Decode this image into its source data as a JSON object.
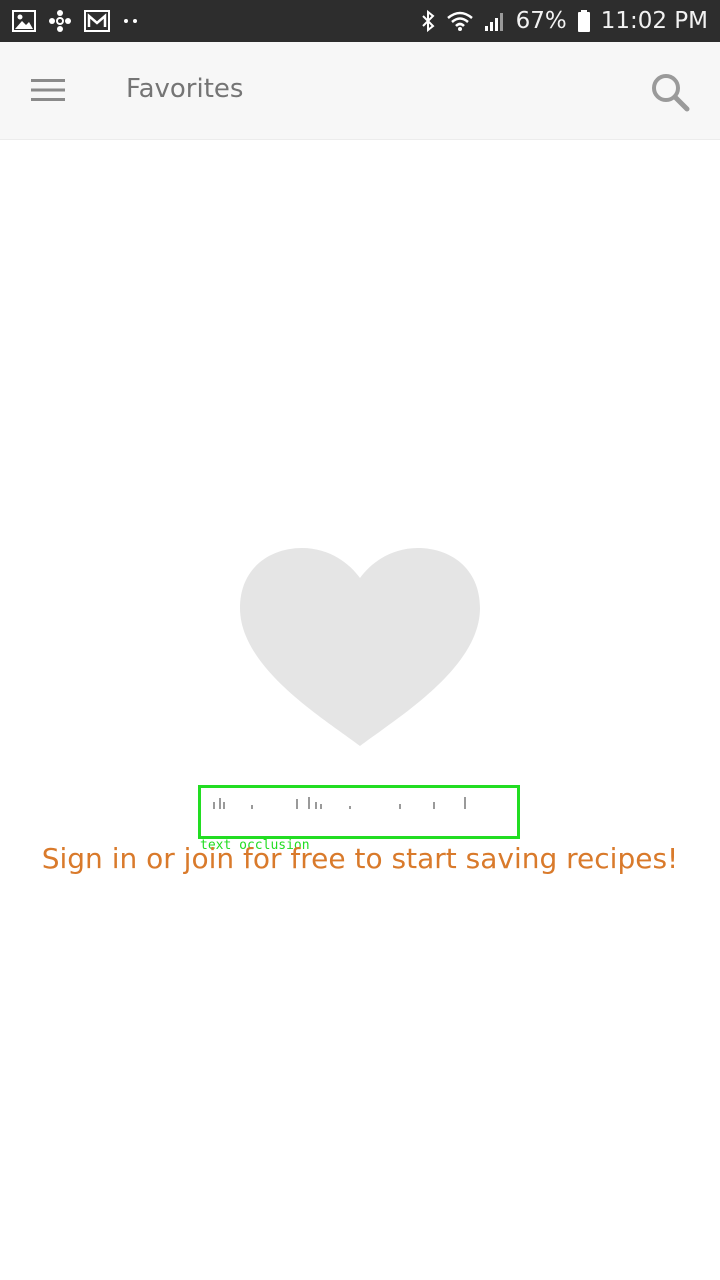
{
  "status_bar": {
    "battery_percent": "67%",
    "time": "11:02 PM",
    "left_icons": [
      "image-icon",
      "fan-icon",
      "gmail-icon",
      "more-dots-icon"
    ],
    "right_icons": [
      "bluetooth-icon",
      "wifi-icon",
      "signal-icon",
      "battery-icon"
    ]
  },
  "app_bar": {
    "title": "Favorites",
    "menu_icon": "hamburger-menu-icon",
    "search_icon": "search-icon"
  },
  "empty_state": {
    "icon": "heart-icon",
    "icon_color": "#e5e5e5",
    "occluded_text": "",
    "occlusion_label": "text occlusion",
    "call_to_action": "Sign in or join for free to start saving recipes!",
    "accent_color": "#d97a2b"
  }
}
